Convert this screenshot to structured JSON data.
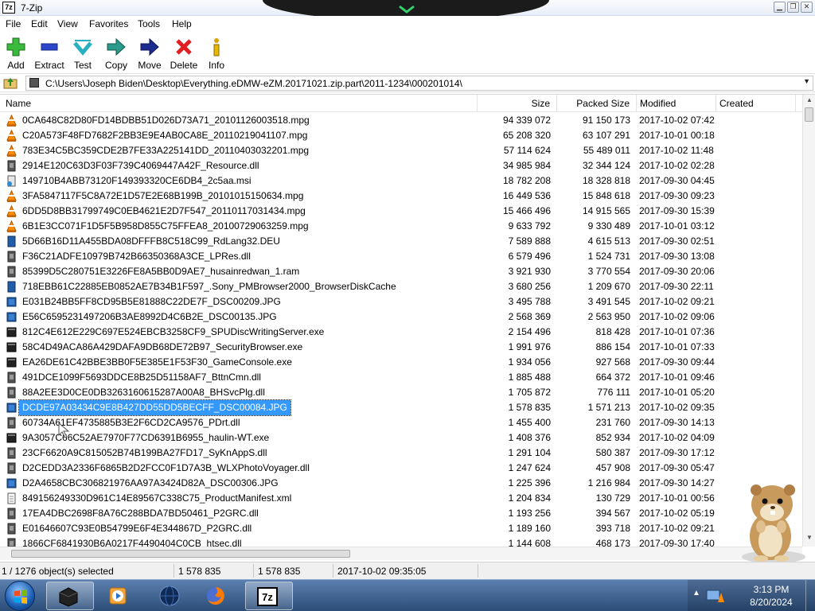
{
  "window": {
    "title": "7-Zip",
    "app_icon_text": "7z"
  },
  "menu": [
    "File",
    "Edit",
    "View",
    "Favorites",
    "Tools",
    "Help"
  ],
  "toolbar": [
    "Add",
    "Extract",
    "Test",
    "Copy",
    "Move",
    "Delete",
    "Info"
  ],
  "path": "C:\\Users\\Joseph Biden\\Desktop\\Everything.eDMW-eZM.20171021.zip.part\\2011-1234\\000201014\\",
  "columns": [
    "Name",
    "Size",
    "Packed Size",
    "Modified",
    "Created"
  ],
  "files": [
    {
      "icon": "vlc-cone-icon",
      "name": "0CA648C82D80FD14BDBB51D026D73A71_20101126003518.mpg",
      "size": "94 339 072",
      "packed": "91 150 173",
      "modified": "2017-10-02 07:42"
    },
    {
      "icon": "vlc-cone-icon",
      "name": "C20A573F48FD7682F2BB3E9E4AB0CA8E_20110219041107.mpg",
      "size": "65 208 320",
      "packed": "63 107 291",
      "modified": "2017-10-01 00:18"
    },
    {
      "icon": "vlc-cone-icon",
      "name": "783E34C5BC359CDE2B7FE33A225141DD_20110403032201.mpg",
      "size": "57 114 624",
      "packed": "55 489 011",
      "modified": "2017-10-02 11:48"
    },
    {
      "icon": "dll-file-icon",
      "name": "2914E120C63D3F03F739C4069447A42F_Resource.dll",
      "size": "34 985 984",
      "packed": "32 344 124",
      "modified": "2017-10-02 02:28"
    },
    {
      "icon": "msi-file-icon",
      "name": "149710B4ABB73120F149393320CE6DB4_2c5aa.msi",
      "size": "18 782 208",
      "packed": "18 328 818",
      "modified": "2017-09-30 04:45"
    },
    {
      "icon": "vlc-cone-icon",
      "name": "3FA5847117F5C8A72E1D57E2E68B199B_20101015150634.mpg",
      "size": "16 449 536",
      "packed": "15 848 618",
      "modified": "2017-09-30 09:23"
    },
    {
      "icon": "vlc-cone-icon",
      "name": "6DD5D8BB31799749C0EB4621E2D7F547_20110117031434.mpg",
      "size": "15 466 496",
      "packed": "14 915 565",
      "modified": "2017-09-30 15:39"
    },
    {
      "icon": "vlc-cone-icon",
      "name": "6B1E3CC071F1D5F5B958D855C75FFEA8_20100729063259.mpg",
      "size": "9 633 792",
      "packed": "9 330 489",
      "modified": "2017-10-01 03:12"
    },
    {
      "icon": "deu-file-icon",
      "name": "5D66B16D11A455BDA08DFFFB8C518C99_RdLang32.DEU",
      "size": "7 589 888",
      "packed": "4 615 513",
      "modified": "2017-09-30 02:51"
    },
    {
      "icon": "dll-file-icon",
      "name": "F36C21ADFE10979B742B66350368A3CE_LPRes.dll",
      "size": "6 579 496",
      "packed": "1 524 731",
      "modified": "2017-09-30 13:08"
    },
    {
      "icon": "dll-file-icon",
      "name": "85399D5C280751E3226FE8A5BB0D9AE7_husainredwan_1.ram",
      "size": "3 921 930",
      "packed": "3 770 554",
      "modified": "2017-09-30 20:06"
    },
    {
      "icon": "deu-file-icon",
      "name": "718EBB61C22885EB0852AE7B34B1F597_.Sony_PMBrowser2000_BrowserDiskCache",
      "size": "3 680 256",
      "packed": "1 209 670",
      "modified": "2017-09-30 22:11"
    },
    {
      "icon": "jpg-file-icon",
      "name": "E031B24BB5FF8CD95B5E81888C22DE7F_DSC00209.JPG",
      "size": "3 495 788",
      "packed": "3 491 545",
      "modified": "2017-10-02 09:21"
    },
    {
      "icon": "jpg-file-icon",
      "name": "E56C6595231497206B3AE8992D4C6B2E_DSC00135.JPG",
      "size": "2 568 369",
      "packed": "2 563 950",
      "modified": "2017-10-02 09:06"
    },
    {
      "icon": "exe-file-icon",
      "name": "812C4E612E229C697E524EBCB3258CF9_SPUDiscWritingServer.exe",
      "size": "2 154 496",
      "packed": "818 428",
      "modified": "2017-10-01 07:36"
    },
    {
      "icon": "exe-file-icon",
      "name": "58C4D49ACA86A429DAFA9DB68DE72B97_SecurityBrowser.exe",
      "size": "1 991 976",
      "packed": "886 154",
      "modified": "2017-10-01 07:33"
    },
    {
      "icon": "exe-file-icon",
      "name": "EA26DE61C42BBE3BB0F5E385E1F53F30_GameConsole.exe",
      "size": "1 934 056",
      "packed": "927 568",
      "modified": "2017-09-30 09:44"
    },
    {
      "icon": "dll-file-icon",
      "name": "491DCE1099F5693DDCE8B25D51158AF7_BttnCmn.dll",
      "size": "1 885 488",
      "packed": "664 372",
      "modified": "2017-10-01 09:46"
    },
    {
      "icon": "dll-file-icon",
      "name": "88A2EE3D0CE0DB3263160615287A00A8_BHSvcPlg.dll",
      "size": "1 705 872",
      "packed": "776 111",
      "modified": "2017-10-01 05:20"
    },
    {
      "icon": "jpg-file-icon",
      "name": "DCDE97A03434C9E8B427DD55DD5BECFF_DSC00084.JPG",
      "size": "1 578 835",
      "packed": "1 571 213",
      "modified": "2017-10-02 09:35",
      "selected": true
    },
    {
      "icon": "dll-file-icon",
      "name": "60734A61EF4735885B3E2F6CD2CA9576_PDrt.dll",
      "size": "1 455 400",
      "packed": "231 760",
      "modified": "2017-09-30 14:13"
    },
    {
      "icon": "exe-file-icon",
      "name": "9A3057C66C52AE7970F77CD6391B6955_haulin-WT.exe",
      "size": "1 408 376",
      "packed": "852 934",
      "modified": "2017-10-02 04:09"
    },
    {
      "icon": "dll-file-icon",
      "name": "23CF6620A9C815052B74B199BA27FD17_SyKnAppS.dll",
      "size": "1 291 104",
      "packed": "580 387",
      "modified": "2017-09-30 17:12"
    },
    {
      "icon": "dll-file-icon",
      "name": "D2CEDD3A2336F6865B2D2FCC0F1D7A3B_WLXPhotoVoyager.dll",
      "size": "1 247 624",
      "packed": "457 908",
      "modified": "2017-09-30 05:47"
    },
    {
      "icon": "jpg-file-icon",
      "name": "D2A4658CBC306821976AA97A3424D82A_DSC00306.JPG",
      "size": "1 225 396",
      "packed": "1 216 984",
      "modified": "2017-09-30 14:27"
    },
    {
      "icon": "xml-file-icon",
      "name": "849156249330D961C14E89567C338C75_ProductManifest.xml",
      "size": "1 204 834",
      "packed": "130 729",
      "modified": "2017-10-01 00:56"
    },
    {
      "icon": "dll-file-icon",
      "name": "17EA4DBC2698F8A76C288BDA7BD50461_P2GRC.dll",
      "size": "1 193 256",
      "packed": "394 567",
      "modified": "2017-10-02 05:19"
    },
    {
      "icon": "dll-file-icon",
      "name": "E01646607C93E0B54799E6F4E344867D_P2GRC.dll",
      "size": "1 189 160",
      "packed": "393 718",
      "modified": "2017-10-02 09:21"
    },
    {
      "icon": "dll-file-icon",
      "name": "1866CF6841930B6A0217F4490404C0CB_htsec.dll",
      "size": "1 144 608",
      "packed": "468 173",
      "modified": "2017-09-30 17:40"
    }
  ],
  "status": {
    "selection": "1 / 1276 object(s) selected",
    "size": "1 578 835",
    "packed": "1 578 835",
    "modified": "2017-10-02 09:35:05"
  },
  "taskbar": {
    "apps": [
      "media-player-icon",
      "media-center-icon",
      "firefox-icon",
      "7zip-icon"
    ],
    "time": "3:13 PM",
    "date": "8/20/2024"
  },
  "colors": {
    "selection": "#3399ff",
    "vlc": "#ff8c00",
    "taskbar": "#2c4d78"
  }
}
